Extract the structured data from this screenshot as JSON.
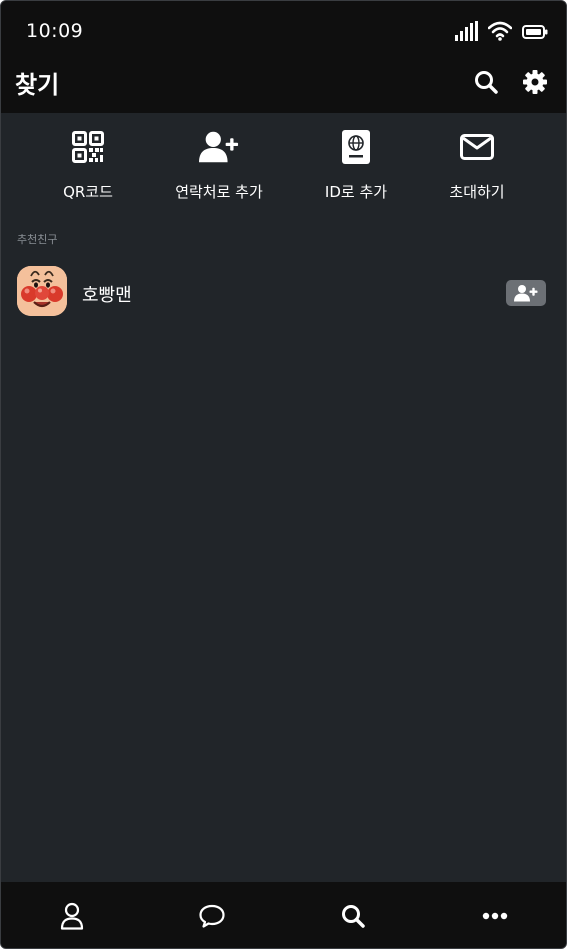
{
  "status_bar": {
    "time": "10:09",
    "icons": [
      "signal-icon",
      "wifi-icon",
      "battery-icon"
    ]
  },
  "header": {
    "title": "찾기",
    "actions": [
      "search-icon",
      "gear-icon"
    ]
  },
  "quick_actions": [
    {
      "label": "QR코드",
      "icon": "qr-code-icon"
    },
    {
      "label": "연락처로 추가",
      "icon": "person-add-icon"
    },
    {
      "label": "ID로 추가",
      "icon": "id-book-icon"
    },
    {
      "label": "초대하기",
      "icon": "envelope-icon"
    }
  ],
  "recommended": {
    "section_label": "추천친구",
    "friends": [
      {
        "name": "호빵맨",
        "avatar": "character-avatar",
        "action_icon": "person-add-icon"
      }
    ]
  },
  "bottom_nav": {
    "items": [
      "person-icon",
      "chat-bubble-icon",
      "search-icon",
      "more-icon"
    ],
    "active": "search-icon"
  },
  "colors": {
    "background": "#212529",
    "top_bar": "#0f0f0f",
    "text": "#ffffff",
    "muted_text": "#8a8f95",
    "add_button": "#6c7075"
  }
}
